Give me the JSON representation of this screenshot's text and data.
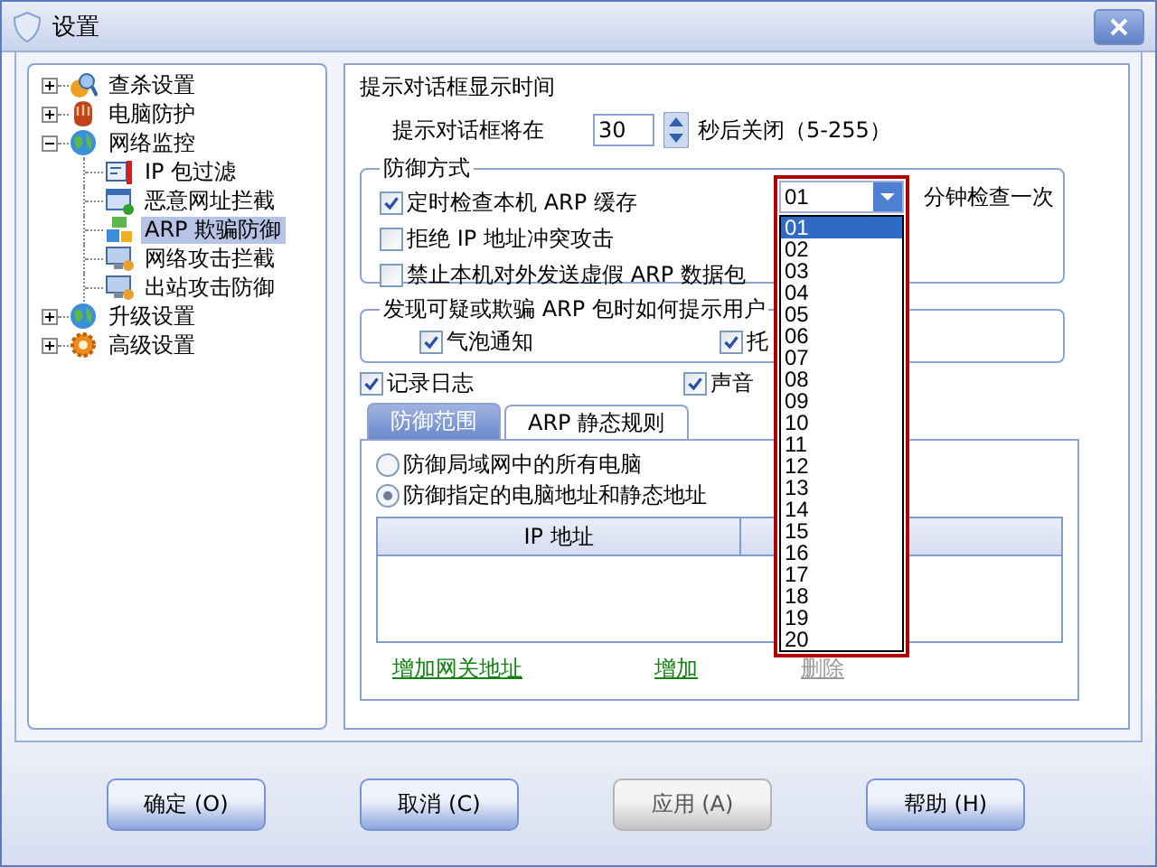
{
  "window": {
    "title": "设置"
  },
  "tree": [
    {
      "label": "查杀设置",
      "expanded": false,
      "selected": false
    },
    {
      "label": "电脑防护",
      "expanded": false,
      "selected": false
    },
    {
      "label": "网络监控",
      "expanded": true,
      "selected": false,
      "children": [
        {
          "label": "IP 包过滤",
          "selected": false
        },
        {
          "label": "恶意网址拦截",
          "selected": false
        },
        {
          "label": "ARP 欺骗防御",
          "selected": true
        },
        {
          "label": "网络攻击拦截",
          "selected": false
        },
        {
          "label": "出站攻击防御",
          "selected": false
        }
      ]
    },
    {
      "label": "升级设置",
      "expanded": false,
      "selected": false
    },
    {
      "label": "高级设置",
      "expanded": false,
      "selected": false
    }
  ],
  "popup_time": {
    "title": "提示对话框显示时间",
    "label": "提示对话框将在",
    "value": "30",
    "suffix": "秒后关闭（5-255）"
  },
  "defense_mode": {
    "title": "防御方式",
    "options": [
      {
        "label": "定时检查本机 ARP 缓存",
        "checked": true
      },
      {
        "label": "拒绝 IP 地址冲突攻击",
        "checked": false
      },
      {
        "label": "禁止本机对外发送虚假 ARP 数据包",
        "checked": false
      }
    ],
    "interval": {
      "value": "01",
      "suffix": "分钟检查一次",
      "expanded": true,
      "options": [
        {
          "label": "01",
          "selected": true
        },
        {
          "label": "02",
          "selected": false
        },
        {
          "label": "03",
          "selected": false
        },
        {
          "label": "04",
          "selected": false
        },
        {
          "label": "05",
          "selected": false
        },
        {
          "label": "06",
          "selected": false
        },
        {
          "label": "07",
          "selected": false
        },
        {
          "label": "08",
          "selected": false
        },
        {
          "label": "09",
          "selected": false
        },
        {
          "label": "10",
          "selected": false
        },
        {
          "label": "11",
          "selected": false
        },
        {
          "label": "12",
          "selected": false
        },
        {
          "label": "13",
          "selected": false
        },
        {
          "label": "14",
          "selected": false
        },
        {
          "label": "15",
          "selected": false
        },
        {
          "label": "16",
          "selected": false
        },
        {
          "label": "17",
          "selected": false
        },
        {
          "label": "18",
          "selected": false
        },
        {
          "label": "19",
          "selected": false
        },
        {
          "label": "20",
          "selected": false
        }
      ]
    }
  },
  "notify": {
    "title": "发现可疑或欺骗 ARP 包时如何提示用户",
    "options": [
      {
        "label": "气泡通知",
        "checked": true
      },
      {
        "label": "托",
        "checked": true
      }
    ]
  },
  "log_options": [
    {
      "label": "记录日志",
      "checked": true
    },
    {
      "label": "声音",
      "checked": true
    }
  ],
  "tabs": [
    {
      "label": "防御范围",
      "selected": true
    },
    {
      "label": "ARP 静态规则",
      "selected": false
    }
  ],
  "scope": {
    "options": [
      {
        "label": "防御局域网中的所有电脑",
        "selected": false
      },
      {
        "label": "防御指定的电脑地址和静态地址",
        "selected": true
      }
    ],
    "table": {
      "columns": [
        "IP 地址"
      ]
    },
    "links": [
      {
        "label": "增加网关地址",
        "disabled": false
      },
      {
        "label": "增加",
        "disabled": false
      },
      {
        "label": "删除",
        "disabled": true
      }
    ]
  },
  "buttons": [
    {
      "label": "确定 (O)",
      "disabled": false
    },
    {
      "label": "取消 (C)",
      "disabled": false
    },
    {
      "label": "应用 (A)",
      "disabled": true
    },
    {
      "label": "帮助 (H)",
      "disabled": false
    }
  ]
}
